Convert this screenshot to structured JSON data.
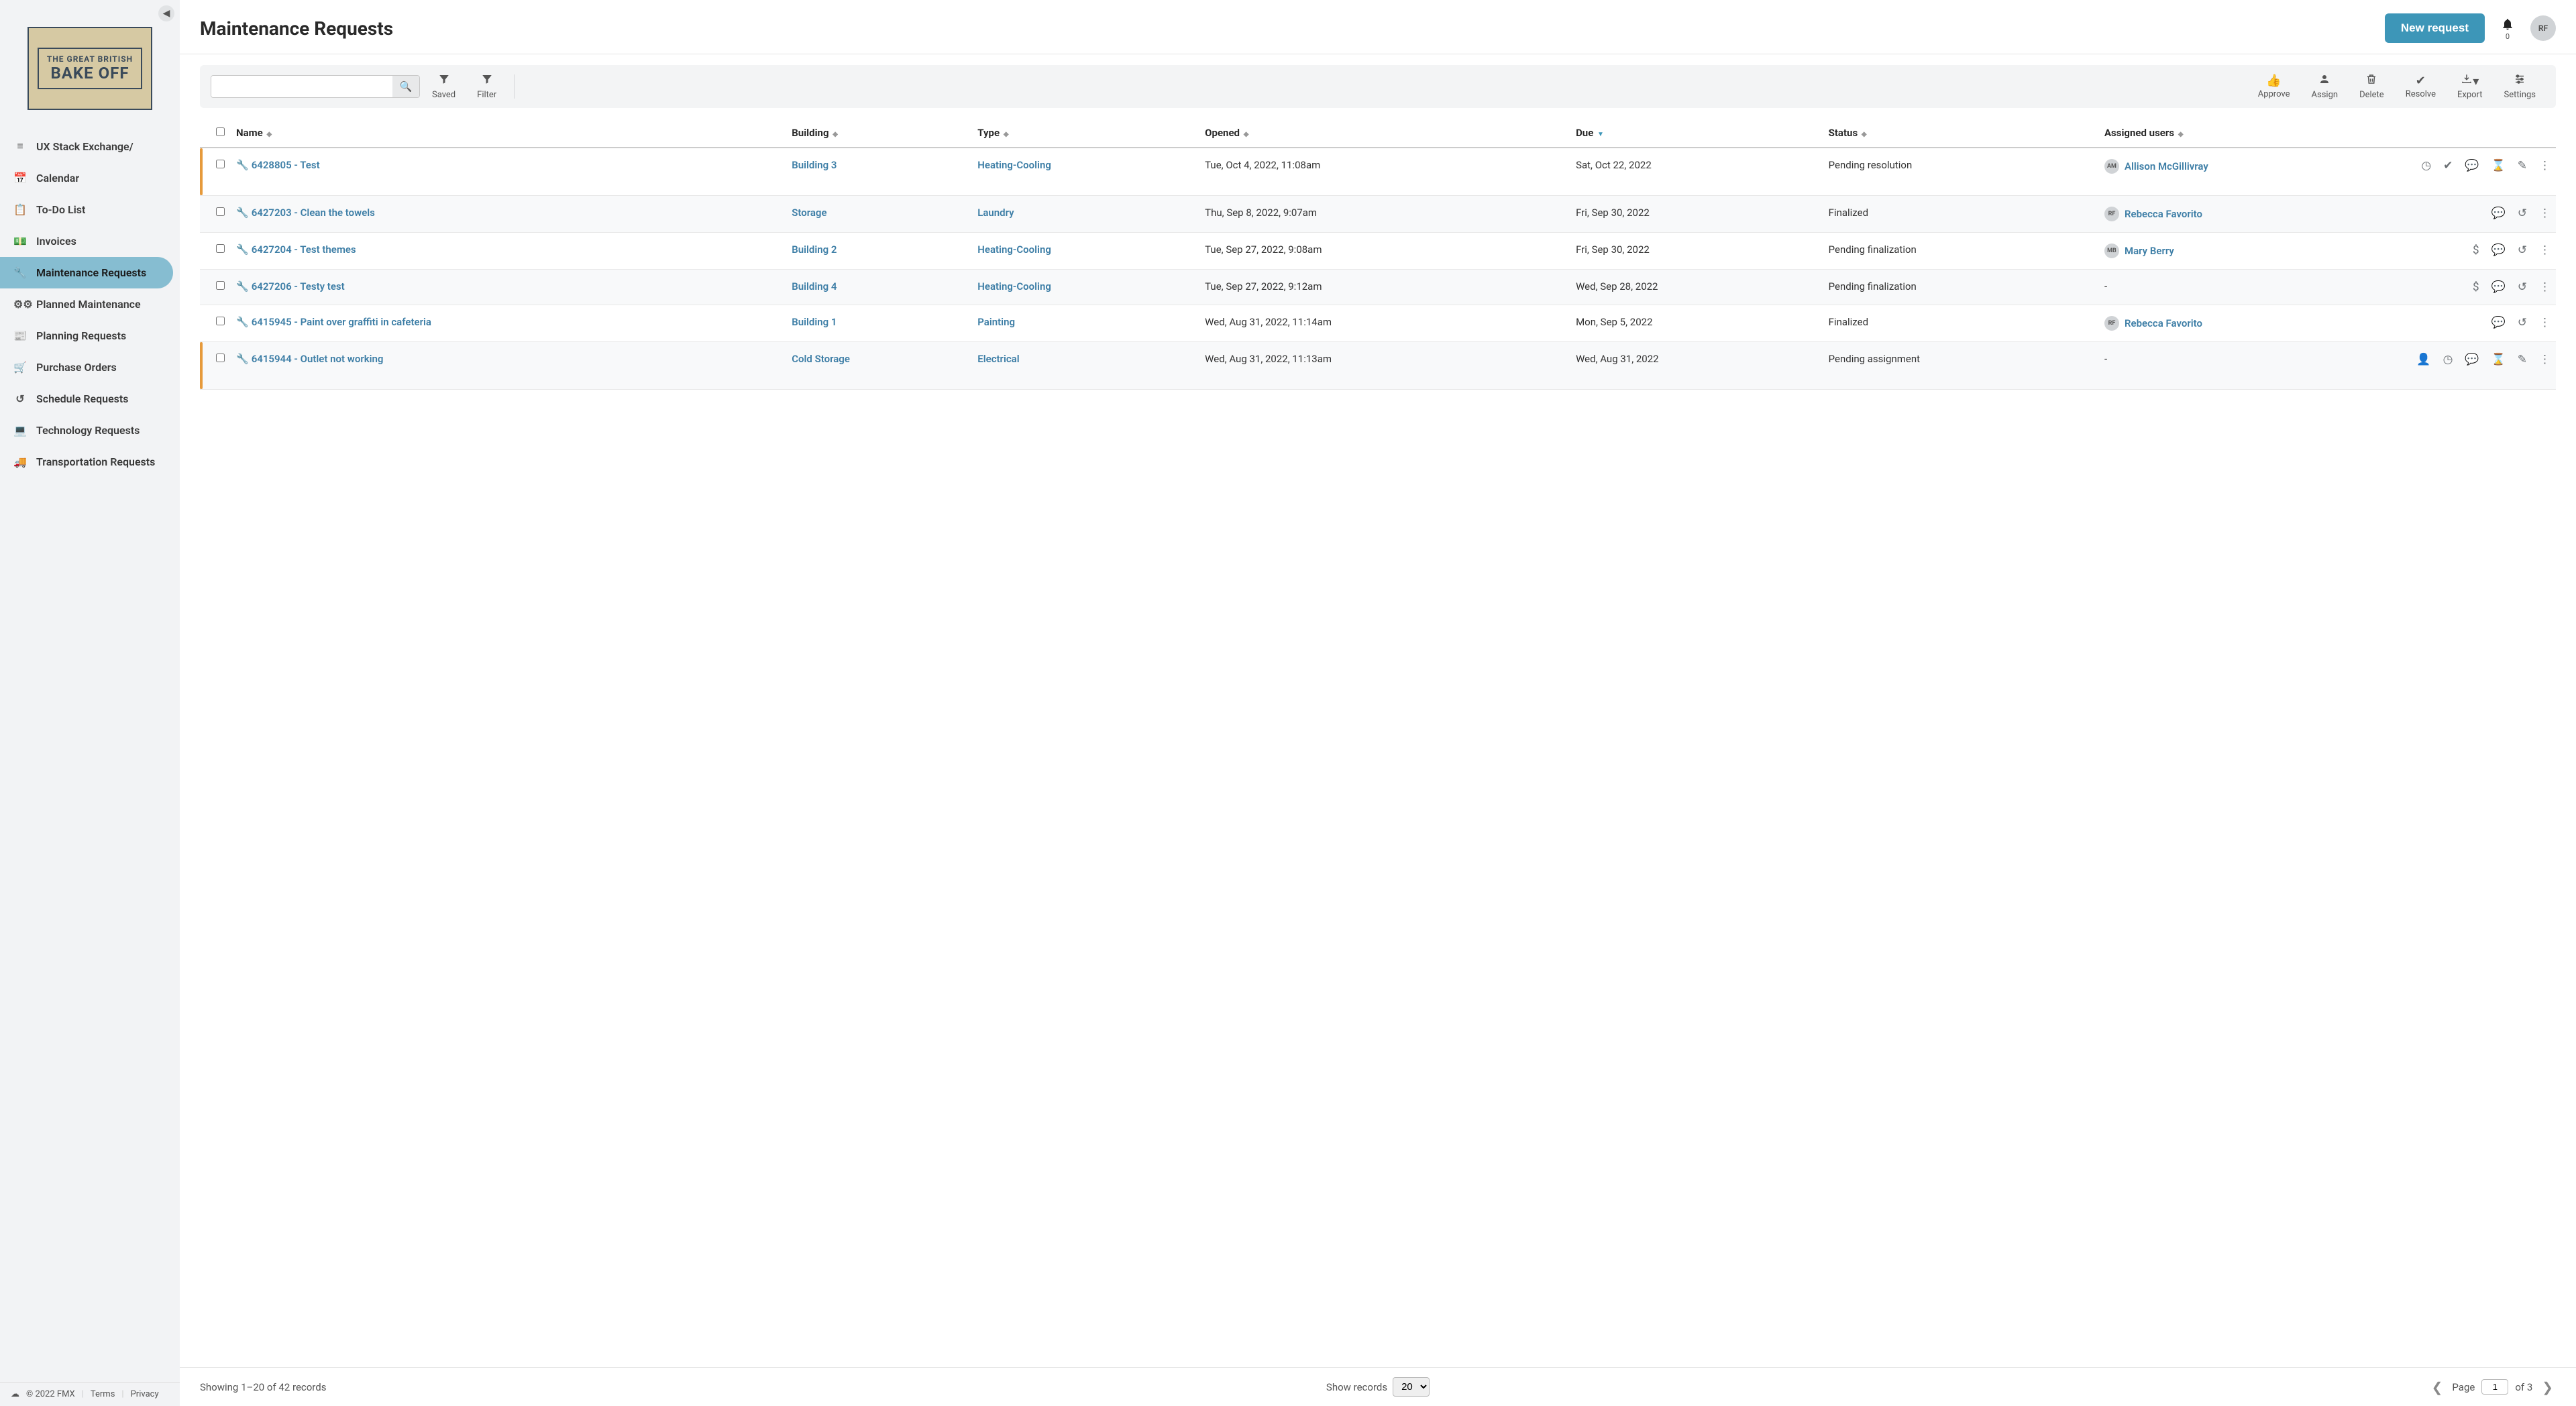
{
  "brand": {
    "line1": "THE GREAT BRITISH",
    "line2": "BAKE OFF"
  },
  "header": {
    "title": "Maintenance Requests",
    "new_request_label": "New request",
    "notif_count": "0",
    "avatar_initials": "RF"
  },
  "sidebar": {
    "items": [
      {
        "icon": "list",
        "label": "UX Stack Exchange/"
      },
      {
        "icon": "calendar",
        "label": "Calendar"
      },
      {
        "icon": "clipboard",
        "label": "To-Do List"
      },
      {
        "icon": "invoice",
        "label": "Invoices"
      },
      {
        "icon": "wrench",
        "label": "Maintenance Requests",
        "active": true
      },
      {
        "icon": "gears",
        "label": "Planned Maintenance"
      },
      {
        "icon": "newspaper",
        "label": "Planning Requests"
      },
      {
        "icon": "cart",
        "label": "Purchase Orders"
      },
      {
        "icon": "history",
        "label": "Schedule Requests"
      },
      {
        "icon": "laptop",
        "label": "Technology Requests"
      },
      {
        "icon": "truck",
        "label": "Transportation Requests"
      }
    ],
    "footer": {
      "copyright": "© 2022 FMX",
      "terms": "Terms",
      "privacy": "Privacy"
    }
  },
  "toolbar": {
    "search_placeholder": "",
    "saved": "Saved",
    "filter": "Filter",
    "approve": "Approve",
    "assign": "Assign",
    "delete": "Delete",
    "resolve": "Resolve",
    "export": "Export",
    "settings": "Settings"
  },
  "table": {
    "headers": {
      "name": "Name",
      "building": "Building",
      "type": "Type",
      "opened": "Opened",
      "due": "Due",
      "status": "Status",
      "assigned": "Assigned users"
    },
    "rows": [
      {
        "flagged": true,
        "name": "6428805 - Test",
        "building": "Building 3",
        "type": "Heating-Cooling",
        "opened": "Tue, Oct 4, 2022, 11:08am",
        "due": "Sat, Oct 22, 2022",
        "status": "Pending resolution",
        "user_initials": "AM",
        "user_name": "Allison McGillivray",
        "actions": [
          "clock",
          "check",
          "comment",
          "hourglass",
          "edit",
          "menu"
        ]
      },
      {
        "flagged": false,
        "name": "6427203 - Clean the towels",
        "building": "Storage",
        "type": "Laundry",
        "opened": "Thu, Sep 8, 2022, 9:07am",
        "due": "Fri, Sep 30, 2022",
        "status": "Finalized",
        "user_initials": "RF",
        "user_name": "Rebecca Favorito",
        "actions": [
          "comment",
          "undo",
          "menu"
        ]
      },
      {
        "flagged": false,
        "name": "6427204 - Test themes",
        "building": "Building 2",
        "type": "Heating-Cooling",
        "opened": "Tue, Sep 27, 2022, 9:08am",
        "due": "Fri, Sep 30, 2022",
        "status": "Pending finalization",
        "user_initials": "MB",
        "user_name": "Mary Berry",
        "actions": [
          "dollar",
          "comment",
          "undo",
          "menu"
        ]
      },
      {
        "flagged": false,
        "name": "6427206 - Testy test",
        "building": "Building 4",
        "type": "Heating-Cooling",
        "opened": "Tue, Sep 27, 2022, 9:12am",
        "due": "Wed, Sep 28, 2022",
        "status": "Pending finalization",
        "user_initials": "",
        "user_name": "-",
        "actions": [
          "dollar",
          "comment",
          "undo",
          "menu"
        ]
      },
      {
        "flagged": false,
        "name": "6415945 - Paint over graffiti in cafeteria",
        "building": "Building 1",
        "type": "Painting",
        "opened": "Wed, Aug 31, 2022, 11:14am",
        "due": "Mon, Sep 5, 2022",
        "status": "Finalized",
        "user_initials": "RF",
        "user_name": "Rebecca Favorito",
        "actions": [
          "comment",
          "undo",
          "menu"
        ]
      },
      {
        "flagged": true,
        "name": "6415944 - Outlet not working",
        "building": "Cold Storage",
        "type": "Electrical",
        "opened": "Wed, Aug 31, 2022, 11:13am",
        "due": "Wed, Aug 31, 2022",
        "status": "Pending assignment",
        "user_initials": "",
        "user_name": "-",
        "actions": [
          "user",
          "clock",
          "comment",
          "hourglass",
          "edit",
          "menu"
        ]
      }
    ]
  },
  "pager": {
    "showing": "Showing 1–20 of 42 records",
    "show_records_label": "Show records",
    "per_page": "20",
    "page_label": "Page",
    "page": "1",
    "of_label": "of 3"
  }
}
